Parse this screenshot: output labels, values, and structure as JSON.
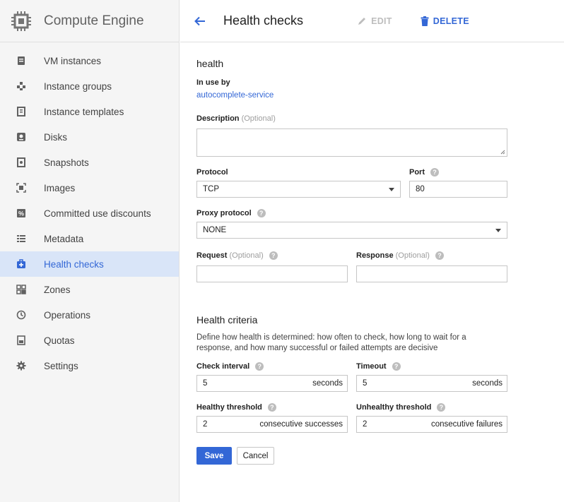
{
  "app": {
    "title": "Compute Engine"
  },
  "sidebar": {
    "items": [
      {
        "label": "VM instances",
        "icon": "vm-instances-icon"
      },
      {
        "label": "Instance groups",
        "icon": "instance-groups-icon"
      },
      {
        "label": "Instance templates",
        "icon": "instance-templates-icon"
      },
      {
        "label": "Disks",
        "icon": "disk-icon"
      },
      {
        "label": "Snapshots",
        "icon": "snapshot-icon"
      },
      {
        "label": "Images",
        "icon": "images-icon"
      },
      {
        "label": "Committed use discounts",
        "icon": "percent-icon"
      },
      {
        "label": "Metadata",
        "icon": "metadata-icon"
      },
      {
        "label": "Health checks",
        "icon": "health-checks-icon",
        "active": true
      },
      {
        "label": "Zones",
        "icon": "zones-icon"
      },
      {
        "label": "Operations",
        "icon": "clock-icon"
      },
      {
        "label": "Quotas",
        "icon": "quotas-icon"
      },
      {
        "label": "Settings",
        "icon": "gear-icon"
      }
    ]
  },
  "topbar": {
    "title": "Health checks",
    "edit_label": "EDIT",
    "delete_label": "DELETE"
  },
  "form": {
    "name": "health",
    "in_use_by_label": "In use by",
    "in_use_by_link": "autocomplete-service",
    "description_label": "Description",
    "optional": "(Optional)",
    "description_value": "",
    "protocol_label": "Protocol",
    "protocol_value": "TCP",
    "port_label": "Port",
    "port_value": "80",
    "proxy_label": "Proxy protocol",
    "proxy_value": "NONE",
    "request_label": "Request",
    "request_value": "",
    "response_label": "Response",
    "response_value": ""
  },
  "criteria": {
    "title": "Health criteria",
    "description": "Define how health is determined: how often to check, how long to wait for a response, and how many successful or failed attempts are decisive",
    "check_interval_label": "Check interval",
    "check_interval_value": "5",
    "check_interval_unit": "seconds",
    "timeout_label": "Timeout",
    "timeout_value": "5",
    "timeout_unit": "seconds",
    "healthy_label": "Healthy threshold",
    "healthy_value": "2",
    "healthy_unit": "consecutive successes",
    "unhealthy_label": "Unhealthy threshold",
    "unhealthy_value": "2",
    "unhealthy_unit": "consecutive failures"
  },
  "actions": {
    "save_label": "Save",
    "cancel_label": "Cancel"
  },
  "colors": {
    "accent": "#3367d6",
    "active_bg": "#d9e5f8",
    "sidebar_bg": "#f5f5f5"
  }
}
